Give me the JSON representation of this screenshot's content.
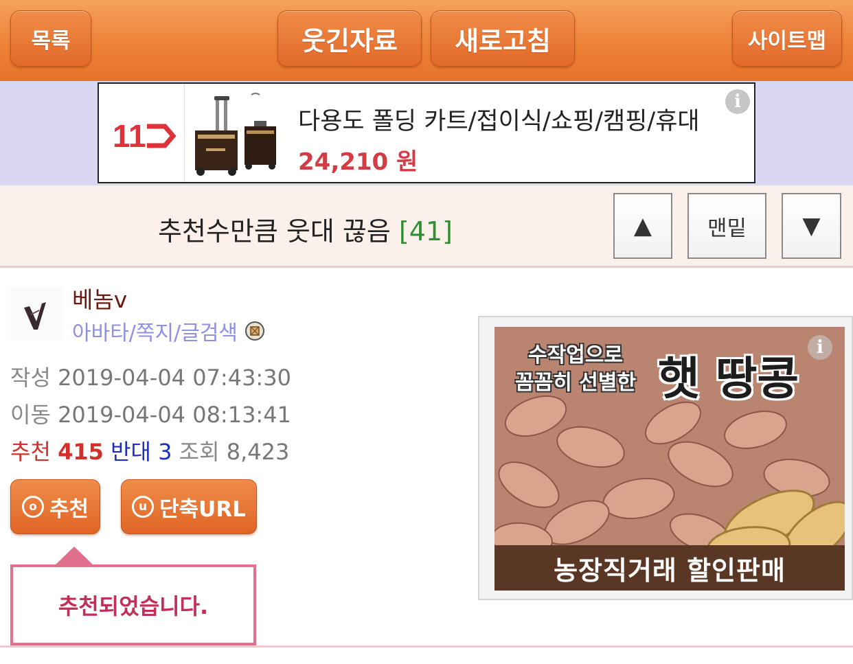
{
  "nav": {
    "list_label": "목록",
    "humor_label": "웃긴자료",
    "refresh_label": "새로고침",
    "sitemap_label": "사이트맵"
  },
  "ad_banner": {
    "logo_text": "11",
    "title": "다용도 폴딩 카트/접이식/쇼핑/캠핑/휴대",
    "price": "24,210 원",
    "info_glyph": "i"
  },
  "post": {
    "title": "추천수만큼 웃대 끊음",
    "comment_count": "[41]",
    "up_label": "▲",
    "bottom_label": "맨밑",
    "down_label": "▼"
  },
  "author": {
    "name": "베놈v",
    "links": "아바타/쪽지/글검색"
  },
  "meta": {
    "written_label": "작성",
    "written_value": "2019-04-04 07:43:30",
    "moved_label": "이동",
    "moved_value": "2019-04-04 08:13:41",
    "recommend_label": "추천",
    "recommend_value": "415",
    "oppose_label": "반대",
    "oppose_value": "3",
    "views_label": "조회",
    "views_value": "8,423"
  },
  "actions": {
    "recommend_icon": "ⓞ",
    "recommend_label": "추천",
    "short_url_icon": "ⓤ",
    "short_url_label": "단축URL",
    "tooltip": "추천되었습니다."
  },
  "side_ad": {
    "line1": "수작업으로",
    "line2": "꼼꼼히 선별한",
    "headline": "햇 땅콩",
    "footer": "농장직거래 할인판매",
    "info_glyph": "i"
  },
  "colors": {
    "nav_orange": "#ee8237",
    "ad_band": "#d9d7f2",
    "price_red": "#d23c45",
    "comment_green": "#2f8f2f",
    "recommend_red": "#d2302a",
    "oppose_blue": "#1d2fbf",
    "tooltip_pink": "#e0708e"
  }
}
